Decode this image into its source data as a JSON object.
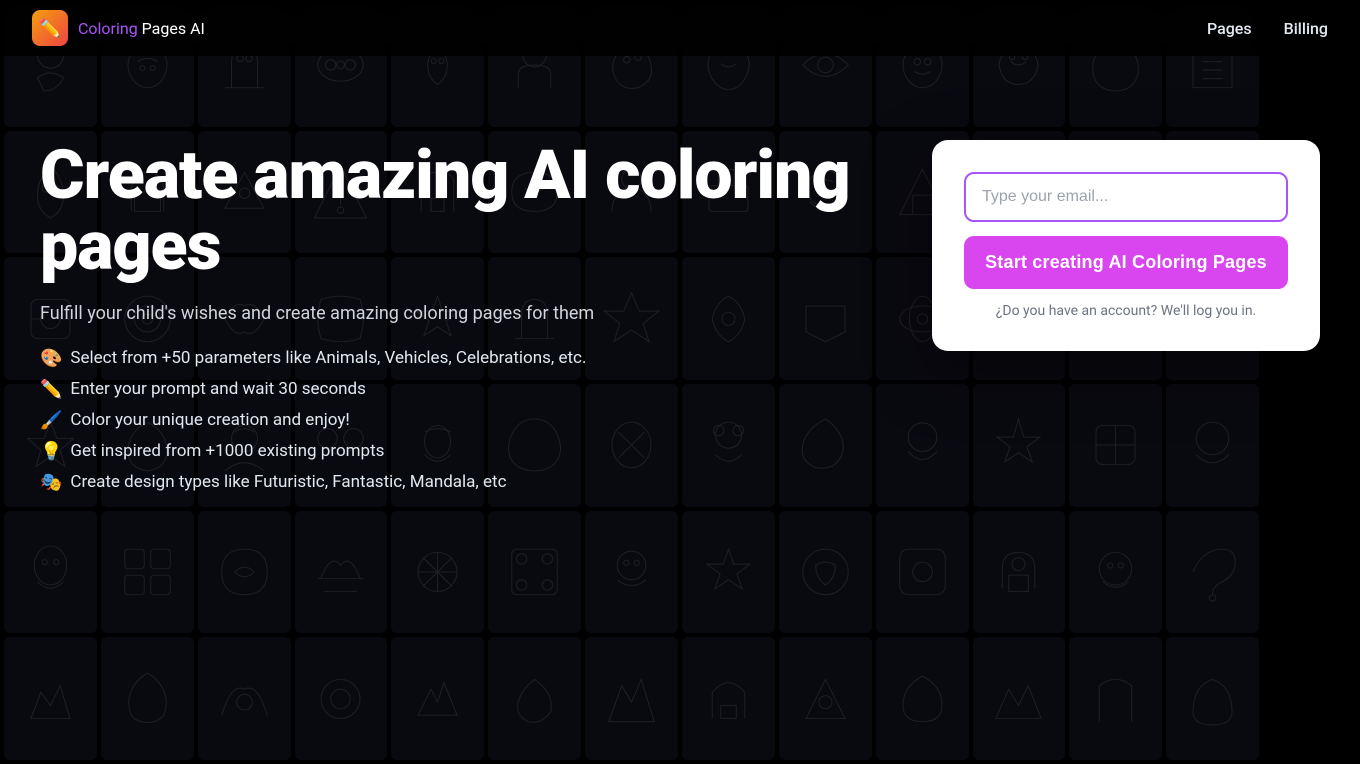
{
  "nav": {
    "logo_icon": "✏️",
    "logo_coloring": "Coloring",
    "logo_rest": " Pages AI",
    "links": [
      {
        "label": "Pages",
        "id": "pages"
      },
      {
        "label": "Billing",
        "id": "billing"
      }
    ]
  },
  "hero": {
    "title": "Create amazing AI coloring pages",
    "subtitle": "Fulfill your child's wishes and create amazing coloring pages for them",
    "features": [
      {
        "emoji": "🎨",
        "text": "Select from +50 parameters like Animals, Vehicles, Celebrations, etc."
      },
      {
        "emoji": "✏️",
        "text": "Enter your prompt and wait 30 seconds"
      },
      {
        "emoji": "🖌️",
        "text": "Color your unique creation and enjoy!"
      },
      {
        "emoji": "💡",
        "text": "Get inspired from +1000 existing prompts"
      },
      {
        "emoji": "🎭",
        "text": "Create design types like Futuristic, Fantastic, Mandala, etc"
      }
    ]
  },
  "form": {
    "email_placeholder": "Type your email...",
    "cta_button": "Start creating AI Coloring Pages",
    "login_text": "¿Do you have an account? We'll log you in."
  },
  "colors": {
    "accent": "#a855f7",
    "cta": "#d946ef",
    "logo_color": "#a855f7"
  }
}
